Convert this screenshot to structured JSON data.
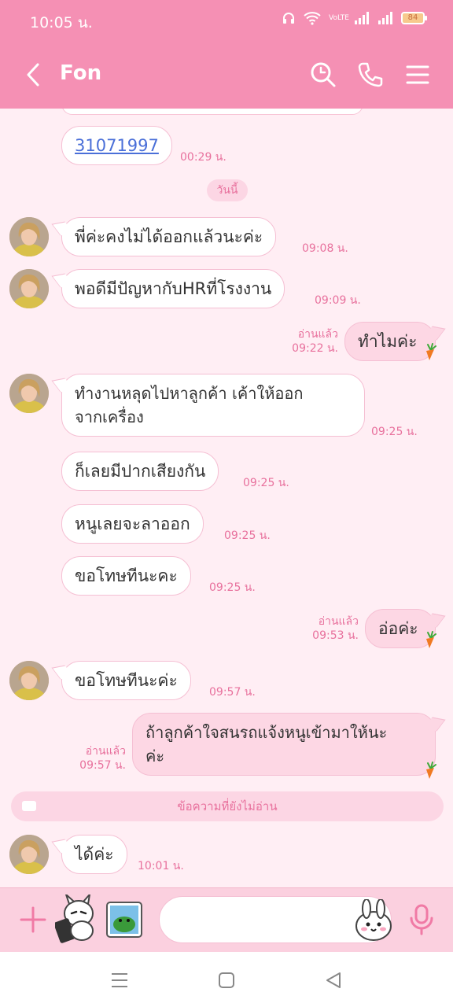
{
  "status_bar": {
    "time": "10:05 น.",
    "battery": "84",
    "icons": [
      "headset-icon",
      "wifi-icon",
      "volte-icon",
      "signal-icon",
      "signal-icon",
      "battery-icon"
    ],
    "volte_label": "VoLTE"
  },
  "header": {
    "contact_name": "Fon",
    "buttons": [
      "back-icon",
      "search-icon",
      "phone-icon",
      "menu-icon"
    ]
  },
  "chat": {
    "date_divider": "วันนี้",
    "unread_divider": "ข้อความที่ยังไม่อ่าน",
    "read_label": "อ่านแล้ว",
    "messages": [
      {
        "from": "them",
        "text": "31071997",
        "time": "00:29 น.",
        "link": true
      },
      {
        "from": "them",
        "text": "พี่ค่ะคงไม่ได้ออกแล้วนะค่ะ",
        "time": "09:08 น."
      },
      {
        "from": "them",
        "text": "พอดีมีปัญหากับHRที่โรงงาน",
        "time": "09:09 น."
      },
      {
        "from": "me",
        "text": "ทำไมค่ะ",
        "time": "09:22 น.",
        "read": "อ่านแล้ว"
      },
      {
        "from": "them",
        "text_line1": "ทำงานหลุดไปหาลูกค้า เค้าให้ออก",
        "text_line2": "จากเครื่อง",
        "time": "09:25 น."
      },
      {
        "from": "them",
        "text": "ก็เลยมีปากเสียงกัน",
        "time": "09:25 น."
      },
      {
        "from": "them",
        "text": "หนูเลยจะลาออก",
        "time": "09:25 น."
      },
      {
        "from": "them",
        "text": "ขอโทษทีนะคะ",
        "time": "09:25 น."
      },
      {
        "from": "me",
        "text": "อ่อค่ะ",
        "time": "09:53 น.",
        "read": "อ่านแล้ว"
      },
      {
        "from": "them",
        "text": "ขอโทษทีนะค่ะ",
        "time": "09:57 น."
      },
      {
        "from": "me",
        "text_line1": "ถ้าลูกค้าใจสนรถแจ้งหนูเข้ามาให้นะ",
        "text_line2": "ค่ะ",
        "time": "09:57 น.",
        "read": "อ่านแล้ว"
      },
      {
        "from": "them",
        "text": "ได้ค่ะ",
        "time": "10:01 น."
      }
    ]
  },
  "input_bar": {
    "placeholder": "",
    "buttons": [
      "plus-icon",
      "sticker-icon",
      "gallery-icon",
      "emoji-icon",
      "mic-icon"
    ]
  },
  "nav_bar": {
    "buttons": [
      "recent-apps-icon",
      "home-icon",
      "back-nav-icon"
    ]
  },
  "colors": {
    "accent": "#f590b4",
    "background": "#ffeef4",
    "bubble_out": "#fdd7e4",
    "time_text": "#e8719d",
    "link": "#4a6fd8"
  }
}
